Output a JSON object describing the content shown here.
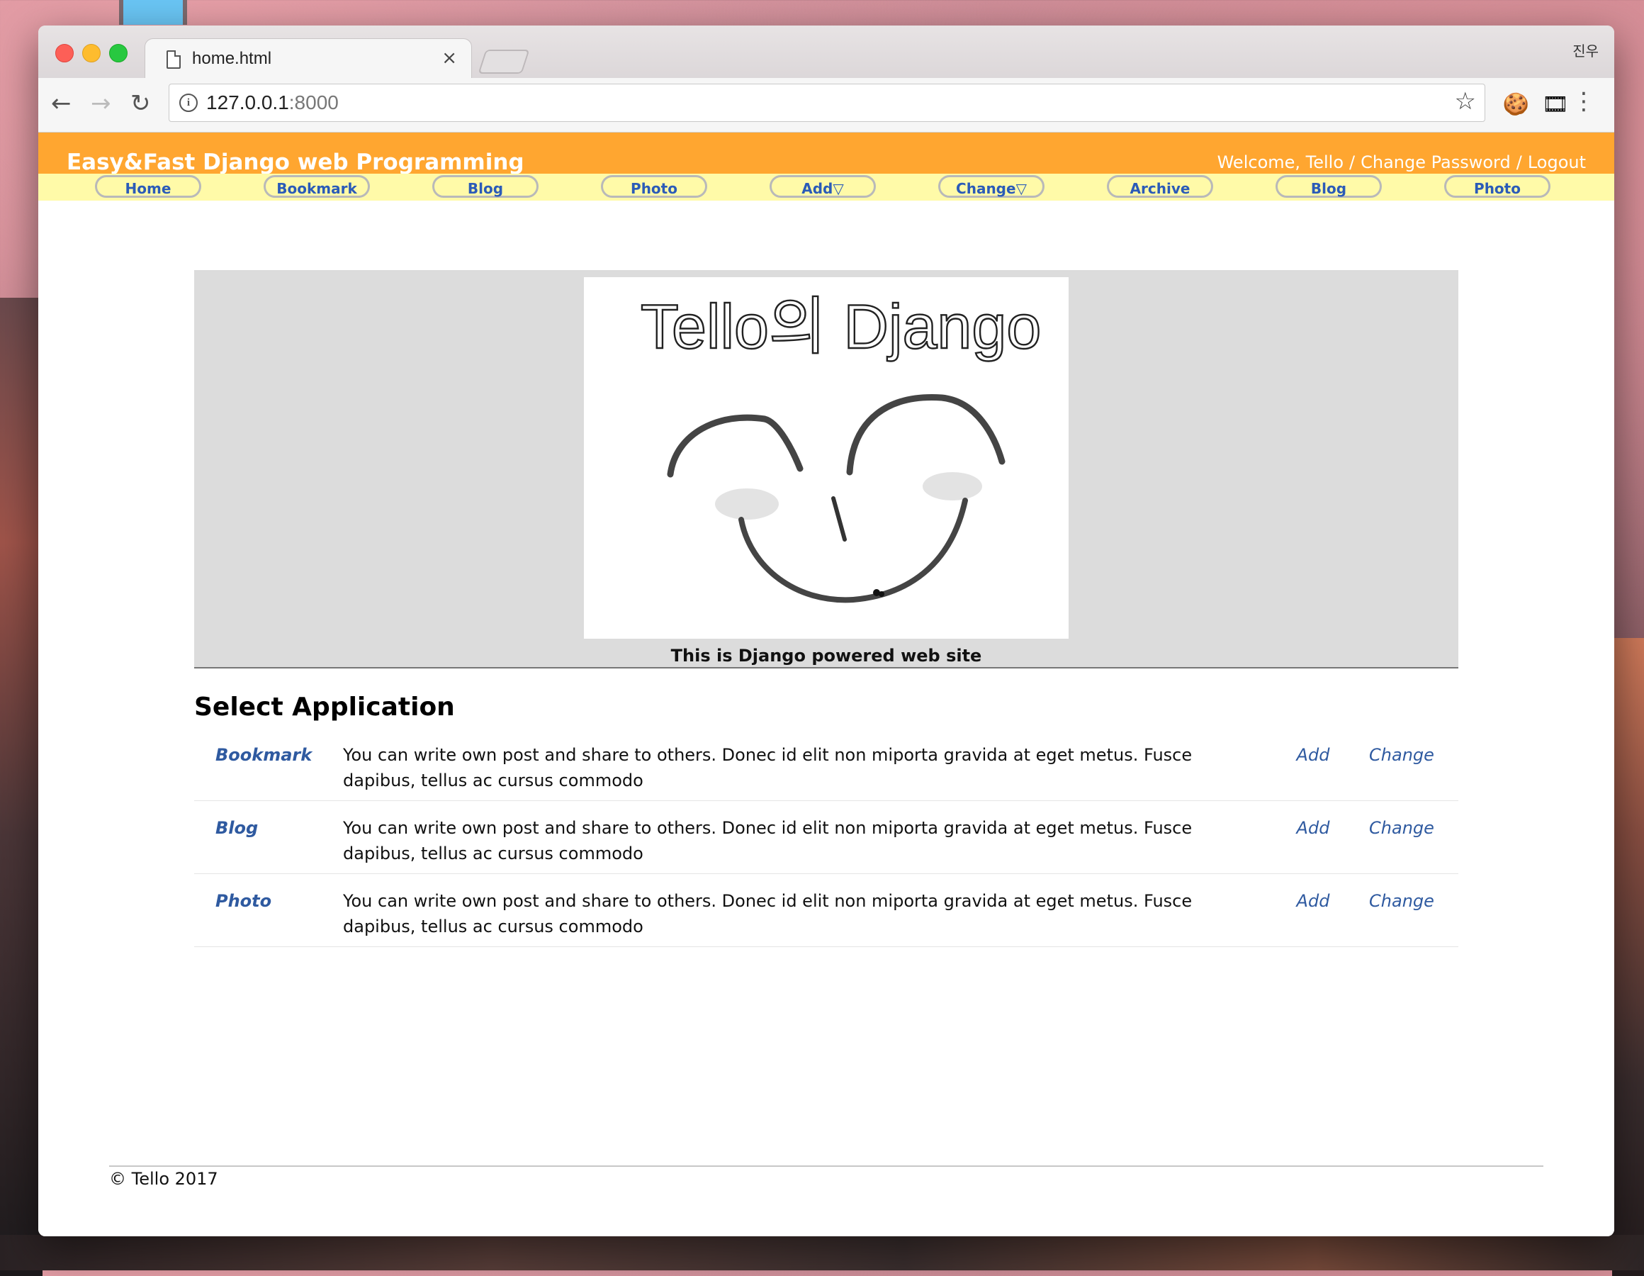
{
  "browser": {
    "tab_title": "home.html",
    "tab_close": "×",
    "profile": "진우",
    "url_host": "127.0.0.1",
    "url_port": ":8000",
    "icons": {
      "back": "←",
      "forward": "→",
      "reload": "↻",
      "info": "i",
      "star": "☆",
      "cookie_ext": "🍪",
      "film_ext": "🎞",
      "menu": "⋮"
    }
  },
  "header": {
    "site_title": "Easy&Fast Django web Programming",
    "welcome": "Welcome, Tello",
    "change_password": "Change Password",
    "logout": "Logout",
    "sep": "/"
  },
  "navbar": {
    "items": [
      "Home",
      "Bookmark",
      "Blog",
      "Photo",
      "Add▽",
      "Change▽",
      "Archive",
      "Blog",
      "Photo"
    ]
  },
  "hero": {
    "image_text": "Tello의 Django",
    "caption": "This is Django powered web site"
  },
  "apps_section": {
    "title": "Select Application",
    "rows": [
      {
        "name": "Bookmark",
        "desc": "You can write own post and share to others. Donec id elit non miporta gravida at eget metus. Fusce dapibus, tellus ac cursus commodo",
        "add": "Add",
        "change": "Change"
      },
      {
        "name": "Blog",
        "desc": "You can write own post and share to others. Donec id elit non miporta gravida at eget metus. Fusce dapibus, tellus ac cursus commodo",
        "add": "Add",
        "change": "Change"
      },
      {
        "name": "Photo",
        "desc": "You can write own post and share to others. Donec id elit non miporta gravida at eget metus. Fusce dapibus, tellus ac cursus commodo",
        "add": "Add",
        "change": "Change"
      }
    ]
  },
  "footer": {
    "copyright": "© Tello 2017"
  },
  "colors": {
    "header_orange": "#ffa630",
    "navbar_yellow": "#fffaa8",
    "link_blue": "#2f5aa0",
    "nav_text_blue": "#2b5bb8"
  }
}
